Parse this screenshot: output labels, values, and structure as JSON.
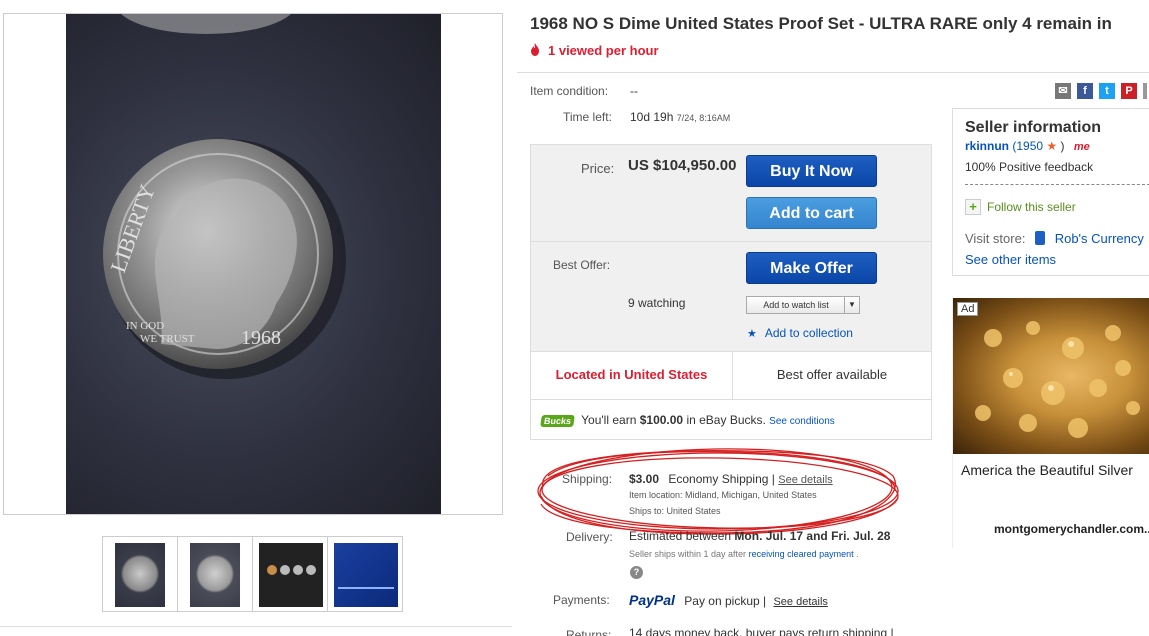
{
  "listing": {
    "title": "1968 NO S Dime United States Proof Set - ULTRA RARE only 4 remain in",
    "viewed": "1 viewed per hour"
  },
  "details": {
    "condition_label": "Item condition:",
    "condition_value": "--",
    "time_left_label": "Time left:",
    "time_left_value": "10d 19h",
    "time_left_end": "7/24, 8:16AM"
  },
  "share": {
    "mail": "✉",
    "facebook": "f",
    "twitter": "t",
    "pinterest": "P"
  },
  "buybox": {
    "price_label": "Price:",
    "price_value": "US $104,950.00",
    "buy_now": "Buy It Now",
    "add_to_cart": "Add to cart",
    "best_offer_label": "Best Offer:",
    "make_offer": "Make Offer",
    "watching": "9 watching",
    "watch_list": "Add to watch list",
    "add_collection": "Add to collection",
    "located": "Located in United States",
    "best_offer_available": "Best offer available",
    "bucks_badge": "Bucks",
    "bucks_pre": "You'll earn",
    "bucks_amount": "$100.00",
    "bucks_post": "in eBay Bucks.",
    "bucks_link": "See conditions"
  },
  "shipping": {
    "label": "Shipping:",
    "cost": "$3.00",
    "service": "Economy Shipping |",
    "details_link": "See details",
    "location": "Item location:  Midland, Michigan, United States",
    "ships_to": "Ships to:  United States"
  },
  "delivery": {
    "label": "Delivery:",
    "estimated": "Estimated between",
    "dates": "Mon. Jul. 17 and Fri. Jul. 28",
    "note_pre": "Seller ships within 1 day after",
    "note_link": "receiving cleared payment",
    "note_post": "."
  },
  "payments": {
    "label": "Payments:",
    "paypal": "PayPal",
    "pickup": "Pay on pickup  |",
    "details_link": "See details"
  },
  "returns": {
    "label": "Returns:",
    "text": "14 days money back, buyer pays return shipping |"
  },
  "seller": {
    "heading": "Seller information",
    "name": "rkinnun",
    "score": "(1950",
    "score_close": ")",
    "feedback": "100% Positive feedback",
    "follow": "Follow this seller",
    "visit_label": "Visit store:",
    "store_name": "Rob's Currency",
    "other_items": "See other items"
  },
  "ad": {
    "tag": "Ad",
    "title": "America the Beautiful Silver",
    "domain": "montgomerychandler.com..."
  },
  "colors": {
    "accent_red": "#dd1e31",
    "link_blue": "#0654ba",
    "button_blue": "#0a46a8"
  }
}
